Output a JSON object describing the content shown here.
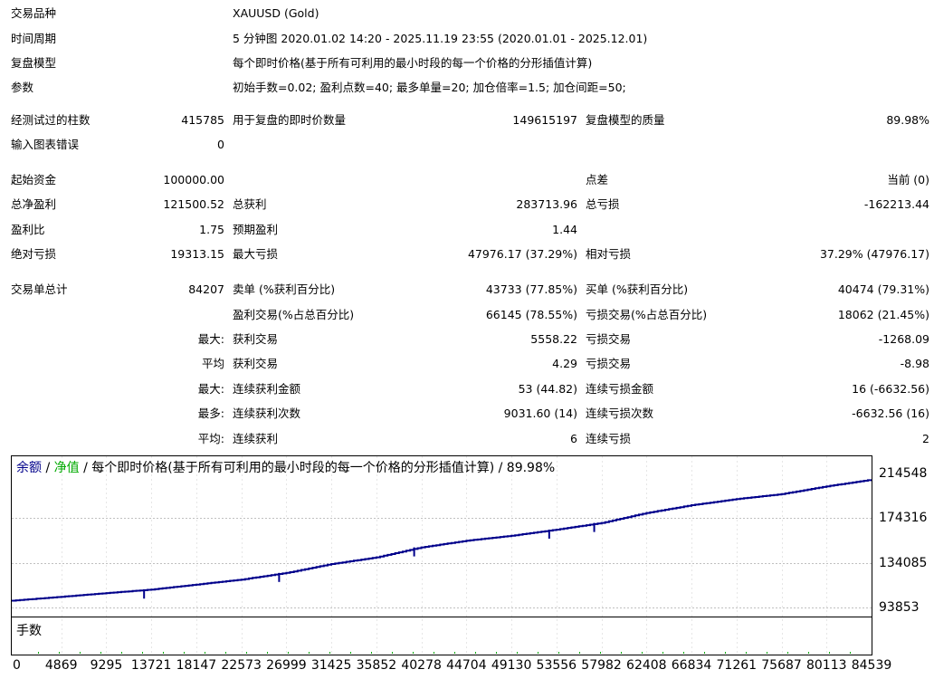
{
  "report": {
    "symbol_label": "交易品种",
    "symbol_value": "XAUUSD (Gold)",
    "period_label": "时间周期",
    "period_value": "5 分钟图 2020.01.02 14:20 - 2025.11.19 23:55 (2020.01.01 - 2025.12.01)",
    "model_label": "复盘模型",
    "model_value": "每个即时价格(基于所有可利用的最小时段的每一个价格的分形插值计算)",
    "params_label": "参数",
    "params_value": "初始手数=0.02; 盈利点数=40; 最多单量=20; 加仓倍率=1.5; 加仓间距=50;",
    "bars_label": "经测试过的柱数",
    "bars_value": "415785",
    "ticks_label": "用于复盘的即时价数量",
    "ticks_value": "149615197",
    "quality_label": "复盘模型的质量",
    "quality_value": "89.98%",
    "errors_label": "输入图表错误",
    "errors_value": "0",
    "deposit_label": "起始资金",
    "deposit_value": "100000.00",
    "spread_label": "点差",
    "spread_value": "当前 (0)",
    "net_label": "总净盈利",
    "net_value": "121500.52",
    "gross_profit_label": "总获利",
    "gross_profit_value": "283713.96",
    "gross_loss_label": "总亏损",
    "gross_loss_value": "-162213.44",
    "pf_label": "盈利比",
    "pf_value": "1.75",
    "payoff_label": "预期盈利",
    "payoff_value": "1.44",
    "abs_dd_label": "绝对亏损",
    "abs_dd_value": "19313.15",
    "max_dd_label": "最大亏损",
    "max_dd_value": "47976.17 (37.29%)",
    "rel_dd_label": "相对亏损",
    "rel_dd_value": "37.29% (47976.17)",
    "trades_label": "交易单总计",
    "trades_value": "84207",
    "short_label": "卖单 (%获利百分比)",
    "short_value": "43733 (77.85%)",
    "long_label": "买单 (%获利百分比)",
    "long_value": "40474 (79.31%)",
    "profit_trades_label": "盈利交易(%占总百分比)",
    "profit_trades_value": "66145 (78.55%)",
    "loss_trades_label": "亏损交易(%占总百分比)",
    "loss_trades_value": "18062 (21.45%)",
    "largest_prefix": "最大:",
    "largest_profit_label": "获利交易",
    "largest_profit_value": "5558.22",
    "largest_loss_label": "亏损交易",
    "largest_loss_value": "-1268.09",
    "avg_prefix": "平均",
    "avg_profit_label": "获利交易",
    "avg_profit_value": "4.29",
    "avg_loss_label": "亏损交易",
    "avg_loss_value": "-8.98",
    "max_consec_prefix": "最大:",
    "max_consec_wins_label": "连续获利金额",
    "max_consec_wins_value": "53 (44.82)",
    "max_consec_losses_label": "连续亏损金额",
    "max_consec_losses_value": "16 (-6632.56)",
    "most_prefix": "最多:",
    "max_consec_profit_label": "连续获利次数",
    "max_consec_profit_value": "9031.60 (14)",
    "max_consec_loss_label": "连续亏损次数",
    "max_consec_loss_value": "-6632.56 (16)",
    "avg_consec_prefix": "平均:",
    "avg_consec_wins_label": "连续获利",
    "avg_consec_wins_value": "6",
    "avg_consec_losses_label": "连续亏损",
    "avg_consec_losses_value": "2"
  },
  "chart": {
    "legend_balance": "余额",
    "legend_sep1": " / ",
    "legend_equity": "净值",
    "legend_sep2": " / ",
    "legend_rest": "每个即时价格(基于所有可利用的最小时段的每一个价格的分形插值计算) / 89.98%",
    "lots_label": "手数"
  },
  "colors": {
    "balance": "#00008b",
    "equity": "#00aa00",
    "grid": "#c0c0c0",
    "frame": "#000000"
  },
  "chart_data": {
    "type": "line",
    "x": [
      0,
      4869,
      9295,
      13721,
      18147,
      22573,
      26999,
      31425,
      35852,
      40278,
      44704,
      49130,
      53556,
      57982,
      62408,
      66834,
      71261,
      75687,
      80113,
      84539
    ],
    "x_ticks": [
      "0",
      "4869",
      "9295",
      "13721",
      "18147",
      "22573",
      "26999",
      "31425",
      "35852",
      "40278",
      "44704",
      "49130",
      "53556",
      "57982",
      "62408",
      "66834",
      "71261",
      "75687",
      "80113",
      "84539"
    ],
    "y_ticks": [
      "214548",
      "174316",
      "134085",
      "93853"
    ],
    "ylim": [
      93853,
      214548
    ],
    "series": [
      {
        "name": "余额",
        "values": [
          100000,
          103500,
          106800,
          110000,
          114500,
          119000,
          125000,
          133000,
          139000,
          148000,
          154000,
          158500,
          164000,
          170000,
          179000,
          186000,
          191500,
          196000,
          203000,
          209000
        ]
      }
    ]
  }
}
